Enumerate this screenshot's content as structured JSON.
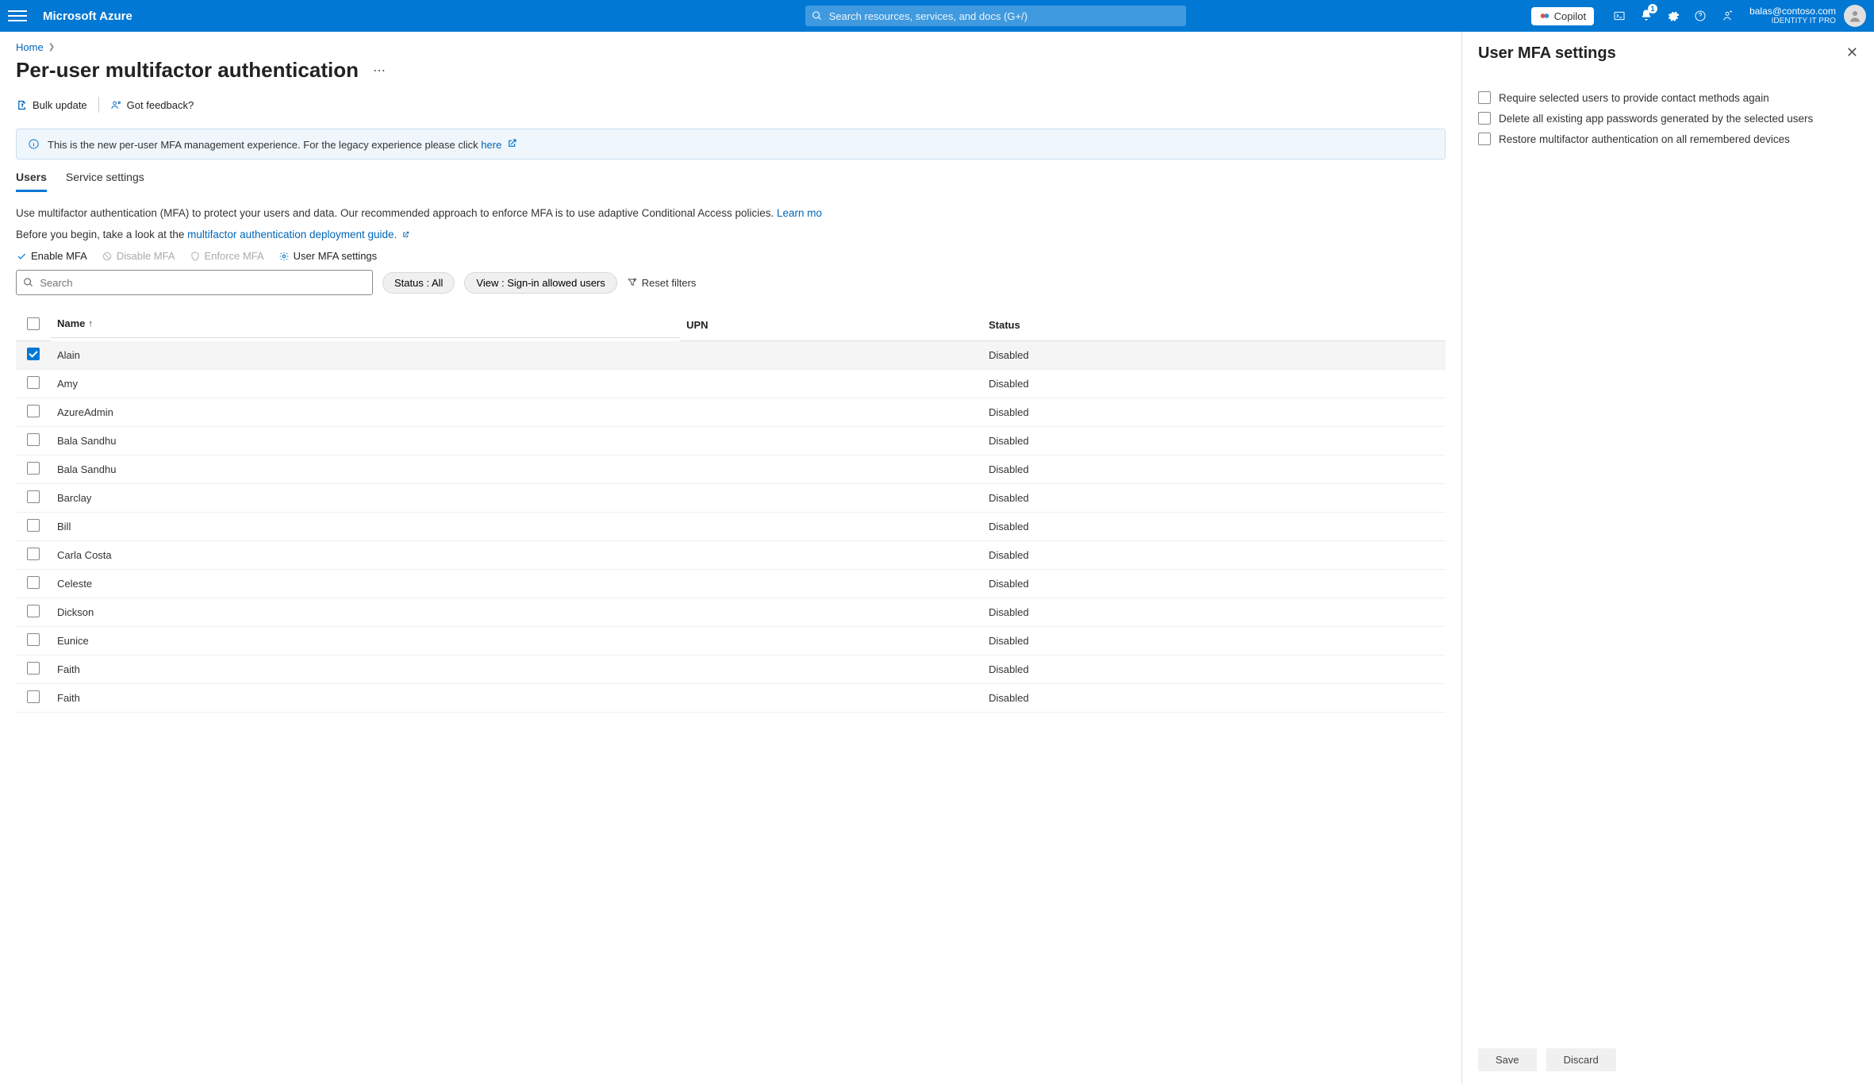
{
  "topbar": {
    "brand": "Microsoft Azure",
    "search_placeholder": "Search resources, services, and docs (G+/)",
    "copilot": "Copilot",
    "notification_count": "1",
    "user_email": "balas@contoso.com",
    "user_tenant": "IDENTITY IT PRO"
  },
  "breadcrumb": {
    "home": "Home"
  },
  "page": {
    "title": "Per-user multifactor authentication",
    "cmd_bulk_update": "Bulk update",
    "cmd_feedback": "Got feedback?"
  },
  "banner": {
    "text": "This is the new per-user MFA management experience. For the legacy experience please click ",
    "link": "here"
  },
  "tabs": {
    "users": "Users",
    "service_settings": "Service settings"
  },
  "body": {
    "line1_pre": "Use multifactor authentication (MFA) to protect your users and data. Our recommended approach to enforce MFA is to use adaptive Conditional Access policies. ",
    "learn_more": "Learn mo",
    "line2_pre": "Before you begin, take a look at the ",
    "line2_link": "multifactor authentication deployment guide."
  },
  "actions": {
    "enable": "Enable MFA",
    "disable": "Disable MFA",
    "enforce": "Enforce MFA",
    "settings": "User MFA settings"
  },
  "filters": {
    "search_placeholder": "Search",
    "status_pill": "Status : All",
    "view_pill": "View : Sign-in allowed users",
    "reset": "Reset filters"
  },
  "columns": {
    "name": "Name",
    "upn": "UPN",
    "status": "Status"
  },
  "rows": [
    {
      "name": "Alain",
      "upn": "",
      "status": "Disabled",
      "selected": true
    },
    {
      "name": "Amy",
      "upn": "",
      "status": "Disabled",
      "selected": false
    },
    {
      "name": "AzureAdmin",
      "upn": "",
      "status": "Disabled",
      "selected": false
    },
    {
      "name": "Bala Sandhu",
      "upn": "",
      "status": "Disabled",
      "selected": false
    },
    {
      "name": "Bala Sandhu",
      "upn": "",
      "status": "Disabled",
      "selected": false
    },
    {
      "name": "Barclay",
      "upn": "",
      "status": "Disabled",
      "selected": false
    },
    {
      "name": "Bill",
      "upn": "",
      "status": "Disabled",
      "selected": false
    },
    {
      "name": "Carla Costa",
      "upn": "",
      "status": "Disabled",
      "selected": false
    },
    {
      "name": "Celeste",
      "upn": "",
      "status": "Disabled",
      "selected": false
    },
    {
      "name": "Dickson",
      "upn": "",
      "status": "Disabled",
      "selected": false
    },
    {
      "name": "Eunice",
      "upn": "",
      "status": "Disabled",
      "selected": false
    },
    {
      "name": "Faith",
      "upn": "",
      "status": "Disabled",
      "selected": false
    },
    {
      "name": "Faith",
      "upn": "",
      "status": "Disabled",
      "selected": false
    }
  ],
  "panel": {
    "title": "User MFA settings",
    "opt1": "Require selected users to provide contact methods again",
    "opt2": "Delete all existing app passwords generated by the selected users",
    "opt3": "Restore multifactor authentication on all remembered devices",
    "save": "Save",
    "discard": "Discard"
  }
}
